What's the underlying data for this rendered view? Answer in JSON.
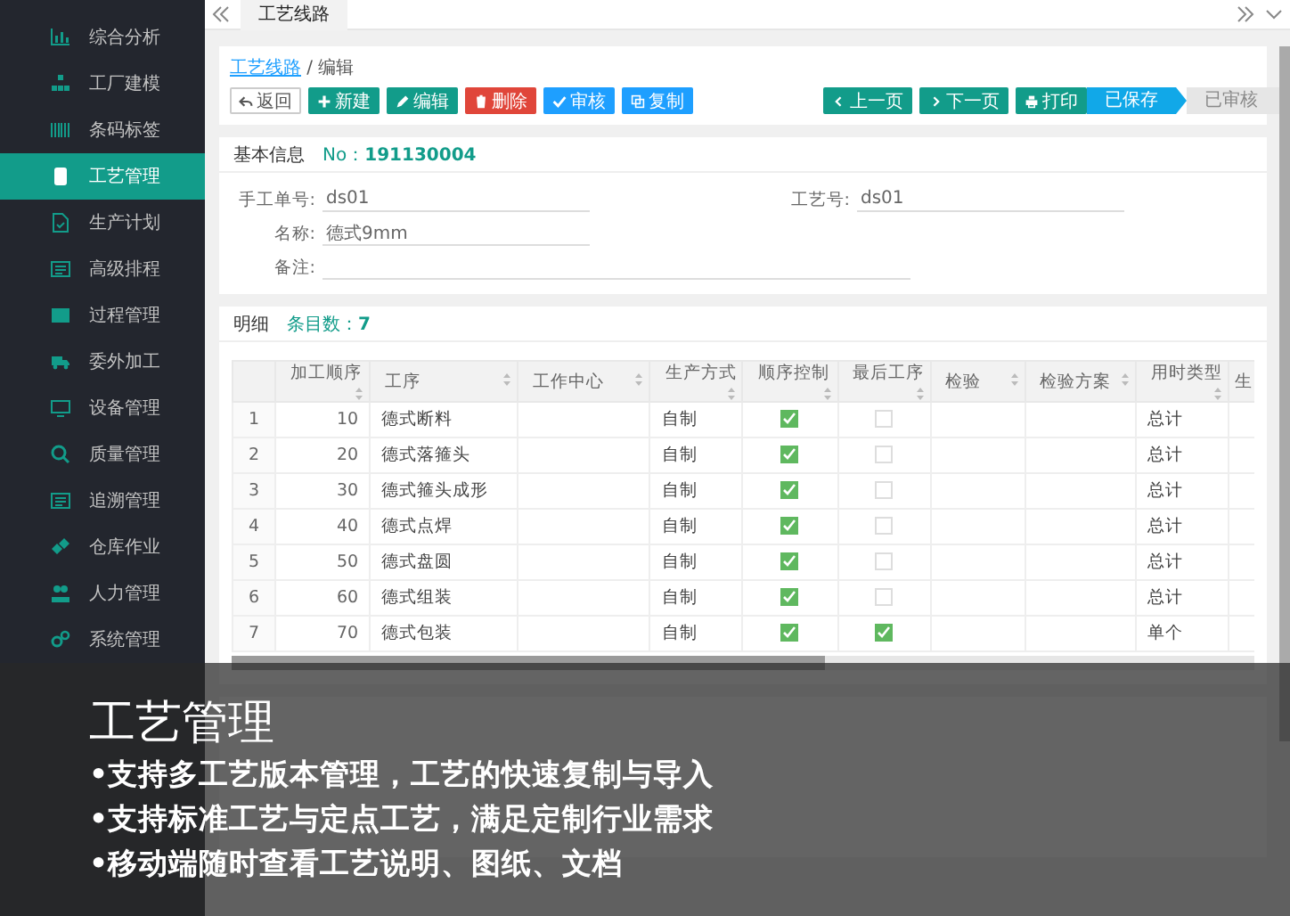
{
  "sidebar": {
    "items": [
      {
        "label": "综合分析",
        "selected": false
      },
      {
        "label": "工厂建模",
        "selected": false
      },
      {
        "label": "条码标签",
        "selected": false
      },
      {
        "label": "工艺管理",
        "selected": true
      },
      {
        "label": "生产计划",
        "selected": false
      },
      {
        "label": "高级排程",
        "selected": false
      },
      {
        "label": "过程管理",
        "selected": false
      },
      {
        "label": "委外加工",
        "selected": false
      },
      {
        "label": "设备管理",
        "selected": false
      },
      {
        "label": "质量管理",
        "selected": false
      },
      {
        "label": "追溯管理",
        "selected": false
      },
      {
        "label": "仓库作业",
        "selected": false
      },
      {
        "label": "人力管理",
        "selected": false
      },
      {
        "label": "系统管理",
        "selected": false
      }
    ]
  },
  "tabs": [
    {
      "label": "工艺线路",
      "selected": true
    }
  ],
  "breadcrumb": {
    "link": "工艺线路",
    "current": "/ 编辑"
  },
  "toolbar": {
    "left": [
      {
        "label": "返回",
        "kind": "default"
      },
      {
        "label": "新建",
        "kind": "green"
      },
      {
        "label": "编辑",
        "kind": "green"
      },
      {
        "label": "删除",
        "kind": "red"
      },
      {
        "label": "审核",
        "kind": "blue"
      },
      {
        "label": "复制",
        "kind": "blue"
      }
    ],
    "center": [
      {
        "label": "上一页",
        "kind": "green"
      },
      {
        "label": "下一页",
        "kind": "green"
      },
      {
        "label": "打印",
        "kind": "green"
      }
    ],
    "steps": [
      {
        "label": "已保存",
        "selected": true
      },
      {
        "label": "已审核",
        "selected": false
      }
    ]
  },
  "basic_info": {
    "title": "基本信息",
    "no_label": "No：",
    "no": "191130004",
    "fields": [
      {
        "label": "手工单号:",
        "value": "ds01"
      },
      {
        "label": "工艺号:",
        "value": "ds01"
      },
      {
        "label": "名称:",
        "value": "德式9mm"
      },
      {
        "label": "备注:"
      }
    ]
  },
  "detail": {
    "title": "明细",
    "count_label": "条目数：",
    "count": "7",
    "columns": [
      "",
      "加工顺序",
      "工序",
      "工作中心",
      "生产方式",
      "顺序控制",
      "最后工序",
      "检验",
      "检验方案",
      "用时类型",
      "生"
    ],
    "rows": [
      {
        "index": "1",
        "order": "10",
        "process": "德式断料",
        "mode": "自制",
        "sequence": true,
        "last": false,
        "time_type": "总计"
      },
      {
        "index": "2",
        "order": "20",
        "process": "德式落箍头",
        "mode": "自制",
        "sequence": true,
        "last": false,
        "time_type": "总计"
      },
      {
        "index": "3",
        "order": "30",
        "process": "德式箍头成形",
        "mode": "自制",
        "sequence": true,
        "last": false,
        "time_type": "总计"
      },
      {
        "index": "4",
        "order": "40",
        "process": "德式点焊",
        "mode": "自制",
        "sequence": true,
        "last": false,
        "time_type": "总计"
      },
      {
        "index": "5",
        "order": "50",
        "process": "德式盘圆",
        "mode": "自制",
        "sequence": true,
        "last": false,
        "time_type": "总计"
      },
      {
        "index": "6",
        "order": "60",
        "process": "德式组装",
        "mode": "自制",
        "sequence": true,
        "last": false,
        "time_type": "总计"
      },
      {
        "index": "7",
        "order": "70",
        "process": "德式包装",
        "mode": "自制",
        "sequence": true,
        "last": true,
        "time_type": "单个"
      }
    ]
  },
  "overlay": {
    "title": "工艺管理",
    "bullets": [
      "•支持多工艺版本管理，工艺的快速复制与导入",
      "•支持标准工艺与定点工艺，满足定制行业需求",
      "•移动端随时查看工艺说明、图纸、文档"
    ]
  }
}
